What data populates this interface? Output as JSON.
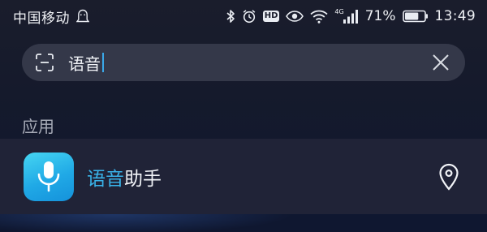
{
  "status_bar": {
    "carrier": "中国移动",
    "hd_label": "HD",
    "network_type": "4G",
    "battery_percent": "71%",
    "battery_level": 0.71,
    "time": "13:49",
    "icons": [
      "ghost-icon",
      "bluetooth-icon",
      "alarm-icon",
      "hd-icon",
      "eye-icon",
      "wifi-icon",
      "signal-icon",
      "battery-icon"
    ]
  },
  "search": {
    "value": "语音",
    "icons": [
      "scan-icon",
      "clear-icon"
    ]
  },
  "section": {
    "label": "应用"
  },
  "results": {
    "apps": [
      {
        "name_highlight": "语音",
        "name_rest": "助手",
        "icon": "microphone-icon",
        "action_icon": "location-icon"
      }
    ]
  },
  "colors": {
    "accent": "#39b2e8",
    "background": "#151a2c",
    "search_bg": "#343849",
    "row_bg": "#202337"
  }
}
